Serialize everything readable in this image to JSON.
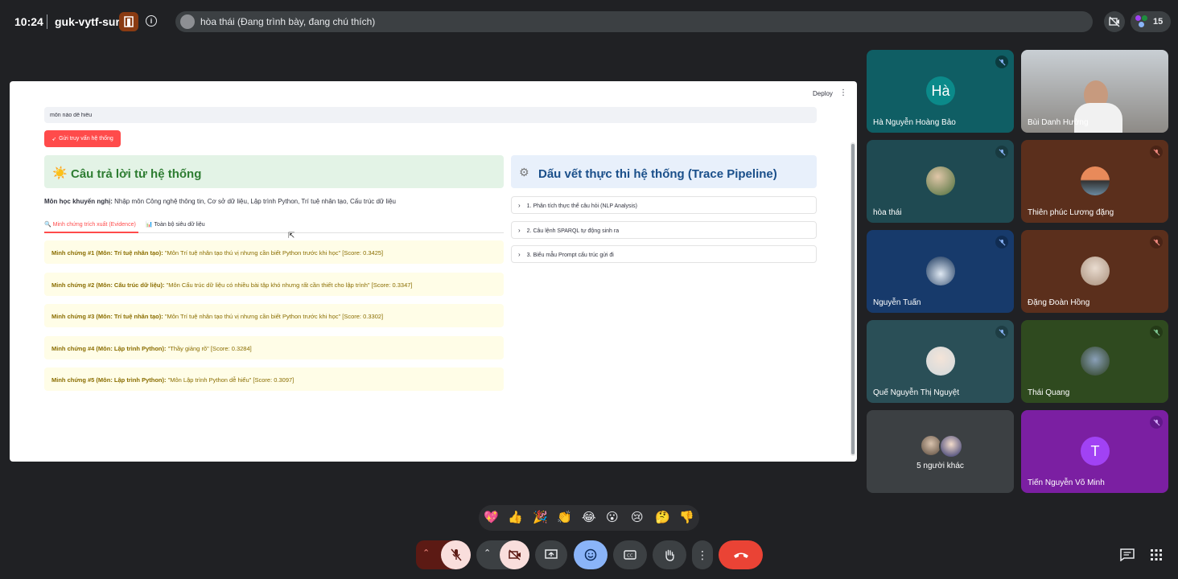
{
  "topbar": {
    "time": "10:24",
    "meeting_code": "guk-vytf-sur",
    "presenting": "hòa thái (Đang trình bày, đang chú thích)",
    "participant_count": "15"
  },
  "app": {
    "deploy_label": "Deploy",
    "query_value": "môn nào dễ hiểu",
    "send_button": "Gửi truy vấn hệ thống",
    "answer_header": "Câu trả lời từ hệ thống",
    "recommend_label": "Môn học khuyến nghị:",
    "recommend_value": " Nhập môn Công nghệ thông tin, Cơ sở dữ liệu, Lập trình Python, Trí tuệ nhân tạo, Cấu trúc dữ liệu",
    "tabs": [
      {
        "label": "Minh chứng trích xuất (Evidence)"
      },
      {
        "label": "Toàn bộ siêu dữ liệu"
      }
    ],
    "evidence": [
      {
        "label": "Minh chứng #1 (Môn: Trí tuệ nhân tạo):",
        "text": " \"Môn Trí tuệ nhân tạo thú vị nhưng cần biết Python trước khi học\" [Score: 0.3425]"
      },
      {
        "label": "Minh chứng #2 (Môn: Cấu trúc dữ liệu):",
        "text": " \"Môn Cấu trúc dữ liệu có nhiều bài tập khó nhưng rất cần thiết cho lập trình\" [Score: 0.3347]"
      },
      {
        "label": "Minh chứng #3 (Môn: Trí tuệ nhân tạo):",
        "text": " \"Môn Trí tuệ nhân tạo thú vị nhưng cần biết Python trước khi học\" [Score: 0.3302]"
      },
      {
        "label": "Minh chứng #4 (Môn: Lập trình Python):",
        "text": " \"Thầy giảng rõ\" [Score: 0.3284]"
      },
      {
        "label": "Minh chứng #5 (Môn: Lập trình Python):",
        "text": " \"Môn Lập trình Python dễ hiểu\" [Score: 0.3097]"
      }
    ],
    "trace_header": "Dấu vết thực thi hệ thống (Trace Pipeline)",
    "trace_items": [
      {
        "label": "1. Phân tích thực thể câu hỏi (NLP Analysis)"
      },
      {
        "label": "2. Câu lệnh SPARQL tự động sinh ra"
      },
      {
        "label": "3. Biểu mẫu Prompt cấu trúc gửi đi"
      }
    ]
  },
  "participants": [
    {
      "name": "Hà Nguyễn Hoàng Bảo",
      "initials": "Hà",
      "bg": "#0f5e64"
    },
    {
      "name": "Bùi Danh Hường",
      "bg": "#8d8a86"
    },
    {
      "name": "hòa thái",
      "bg": "#1f4a52"
    },
    {
      "name": "Thiên phúc Lương đặng",
      "bg": "#5b2f1c"
    },
    {
      "name": "Nguyễn Tuấn",
      "bg": "#173a6b"
    },
    {
      "name": "Đặng Đoàn Hồng",
      "bg": "#5b2f1c"
    },
    {
      "name": "Quế Nguyễn Thị Nguyệt",
      "bg": "#2a4f57"
    },
    {
      "name": "Thái Quang",
      "bg": "#2f4a1f"
    },
    {
      "name": "5 người khác",
      "bg": "#3c4043"
    },
    {
      "name": "Tiến Nguyễn Võ Minh",
      "initials": "T",
      "bg": "#7b1fa2"
    }
  ],
  "reactions": [
    "💖",
    "👍",
    "🎉",
    "👏",
    "😂",
    "😮",
    "😢",
    "🤔",
    "👎"
  ],
  "colors": {
    "accent_red": "#ff4b4b",
    "end_call_red": "#ea4335",
    "emoji_blue": "#8ab4f8"
  }
}
